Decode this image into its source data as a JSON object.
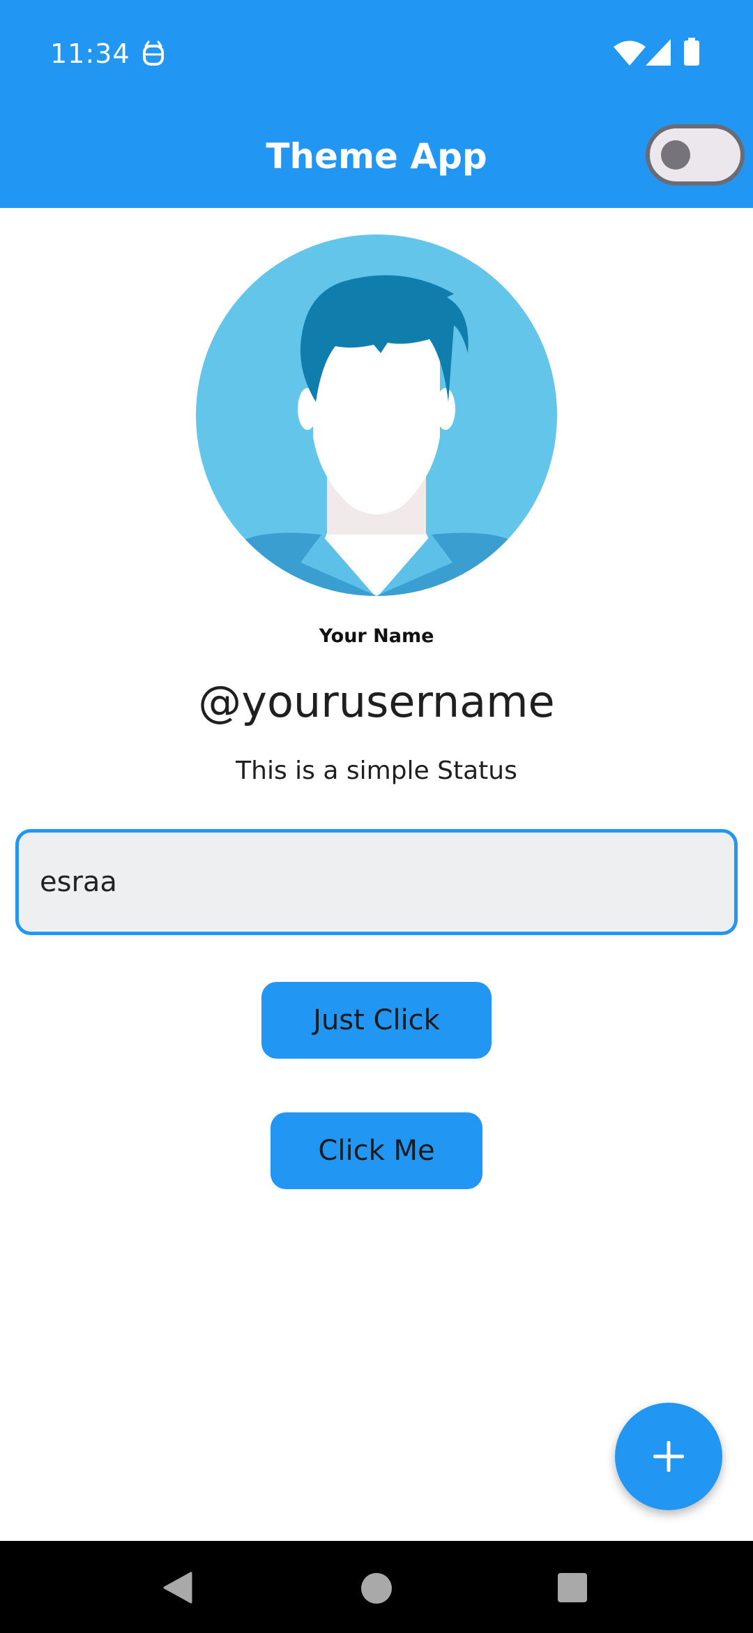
{
  "status_bar": {
    "time": "11:34",
    "icons": [
      "android-debug-icon",
      "wifi-icon",
      "cell-signal-icon",
      "battery-icon"
    ]
  },
  "app_bar": {
    "title": "Theme App",
    "theme_switch_on": false
  },
  "profile": {
    "avatar_icon": "user-avatar-icon",
    "name_label": "Your Name",
    "username": "@yourusername",
    "status": "This is a simple Status"
  },
  "form": {
    "input_value": "esraa"
  },
  "buttons": {
    "just_click": "Just Click",
    "click_me": "Click Me"
  },
  "fab": {
    "icon": "plus-icon"
  },
  "nav_bar": {
    "icons": [
      "back-icon",
      "home-icon",
      "recents-icon"
    ]
  },
  "colors": {
    "primary": "#2196f3",
    "avatar_bg": "#63c5ea",
    "hair": "#0f7ead",
    "input_bg": "#eeeff0"
  }
}
